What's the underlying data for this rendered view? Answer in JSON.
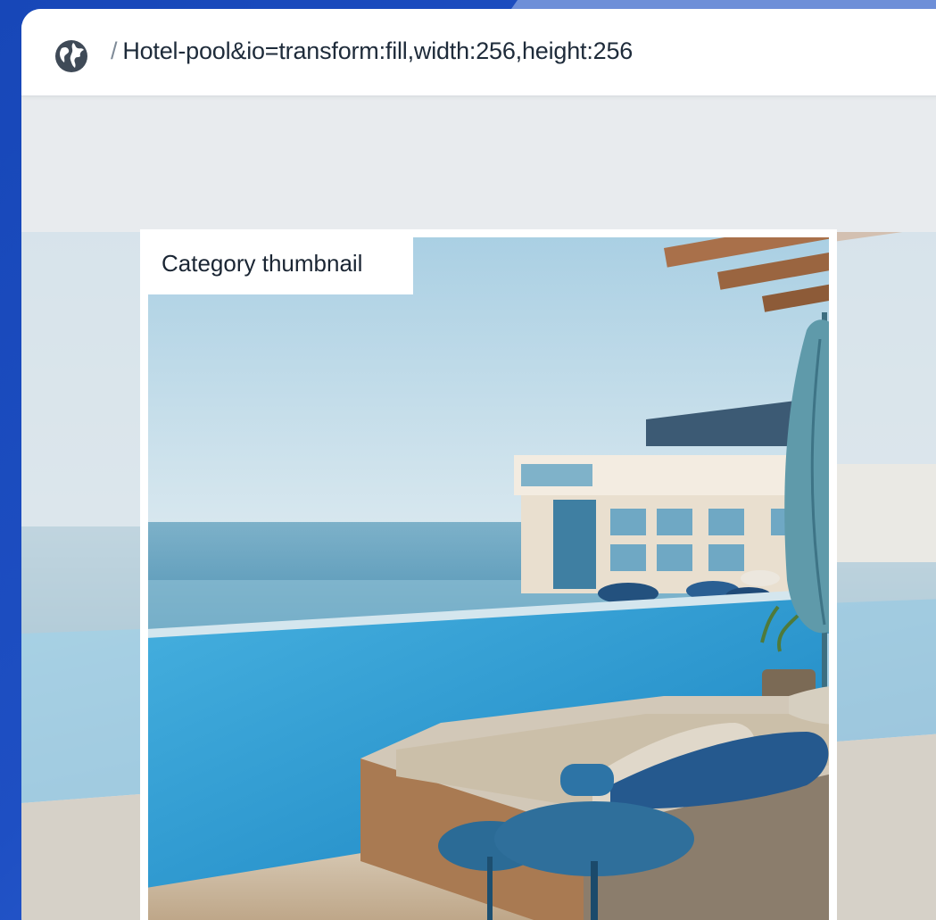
{
  "address_bar": {
    "icon": "globe-icon",
    "separator": "/",
    "url": "Hotel-pool&io=transform:fill,width:256,height:256"
  },
  "thumbnail": {
    "label": "Category thumbnail",
    "image": "hotel-pool-photo"
  },
  "colors": {
    "background": "#1e4fc3",
    "window": "#e8ebee",
    "address_bar": "#ffffff",
    "text": "#1e2b3a"
  }
}
